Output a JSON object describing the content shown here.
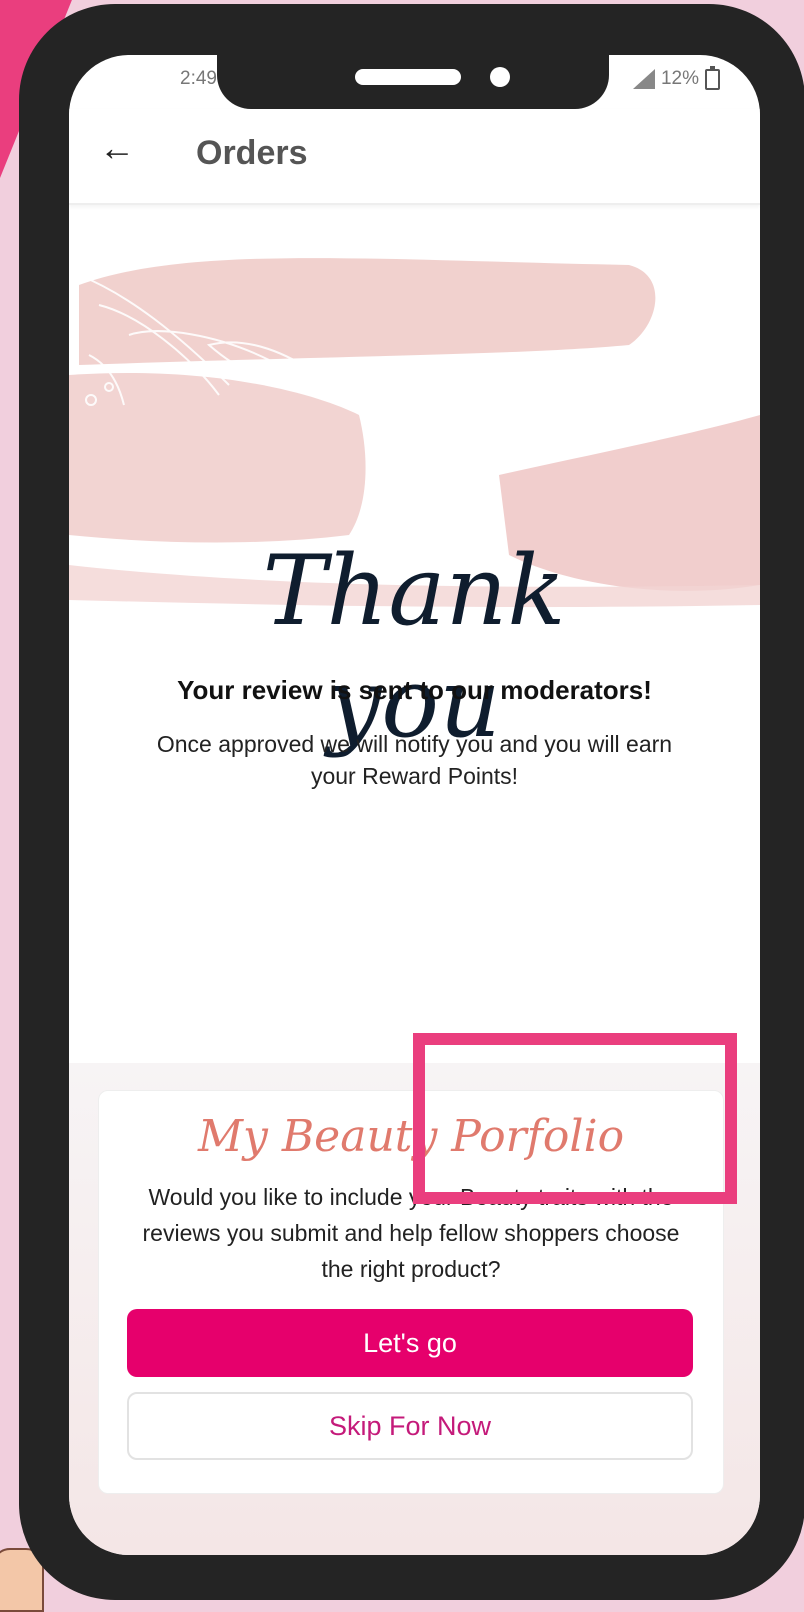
{
  "status_bar": {
    "time": "2:49",
    "battery": "12%"
  },
  "header": {
    "back_icon": "arrow-left-icon",
    "title": "Orders"
  },
  "hero": {
    "script_title": "Thank you"
  },
  "message": {
    "headline": "Your review is sent to our moderators!",
    "body": "Once approved we will notify you and you will earn your Reward Points!"
  },
  "portfolio_card": {
    "title": "My Beauty Porfolio",
    "description": "Would you like to include your Beauty traits with the reviews you submit and help fellow shoppers choose the right product?",
    "primary_button": "Let's go",
    "secondary_button": "Skip For Now"
  },
  "colors": {
    "accent_pink": "#e6006c",
    "highlight_border": "#ea3e7e",
    "background": "#f1cfdd",
    "card_title": "#e07a6d"
  }
}
